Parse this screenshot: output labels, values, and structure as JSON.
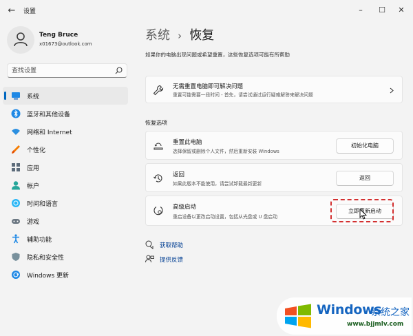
{
  "window": {
    "title": "设置",
    "back_label": "←",
    "minimize_label": "–",
    "maximize_label": "☐",
    "close_label": "✕"
  },
  "profile": {
    "name": "Teng Bruce",
    "email": "x01673@outlook.com"
  },
  "search": {
    "placeholder": "查找设置"
  },
  "sidebar": {
    "items": [
      {
        "label": "系统",
        "icon": "monitor-icon",
        "active": true
      },
      {
        "label": "蓝牙和其他设备",
        "icon": "bluetooth-icon"
      },
      {
        "label": "网络和 Internet",
        "icon": "wifi-icon"
      },
      {
        "label": "个性化",
        "icon": "brush-icon"
      },
      {
        "label": "应用",
        "icon": "apps-icon"
      },
      {
        "label": "帐户",
        "icon": "person-icon"
      },
      {
        "label": "时间和语言",
        "icon": "globe-clock-icon"
      },
      {
        "label": "游戏",
        "icon": "gamepad-icon"
      },
      {
        "label": "辅助功能",
        "icon": "accessibility-icon"
      },
      {
        "label": "隐私和安全性",
        "icon": "shield-icon"
      },
      {
        "label": "Windows 更新",
        "icon": "sync-icon"
      }
    ]
  },
  "main": {
    "breadcrumb_parent": "系统",
    "breadcrumb_sep": "›",
    "breadcrumb_current": "恢复",
    "description": "如果你的电脑出现问题或希望重置，这些恢复选项可能有所帮助",
    "fix_card": {
      "title": "无需重置电脑即可解决问题",
      "subtitle": "重置可能需要一段时间 - 首先，请尝试通过运行疑难解答来解决问题"
    },
    "section_label": "恢复选项",
    "options": [
      {
        "title": "重置此电脑",
        "subtitle": "选择保留或删除个人文件，然后重新安装 Windows",
        "button": "初始化电脑"
      },
      {
        "title": "返回",
        "subtitle": "如果此版本不能使用，请尝试卸载最新更新",
        "button": "返回"
      },
      {
        "title": "高级启动",
        "subtitle": "重启设备以更改启动设置，包括从光盘或 U 盘启动",
        "button": "立即重新启动"
      }
    ],
    "links": [
      {
        "label": "获取帮助"
      },
      {
        "label": "提供反馈"
      }
    ]
  },
  "watermark": {
    "title": "Windows",
    "cn": "系统之家",
    "url": "www.bjjmlv.com"
  },
  "colors": {
    "accent": "#0067c0",
    "highlight": "#d32f2f",
    "link": "#003e92"
  }
}
